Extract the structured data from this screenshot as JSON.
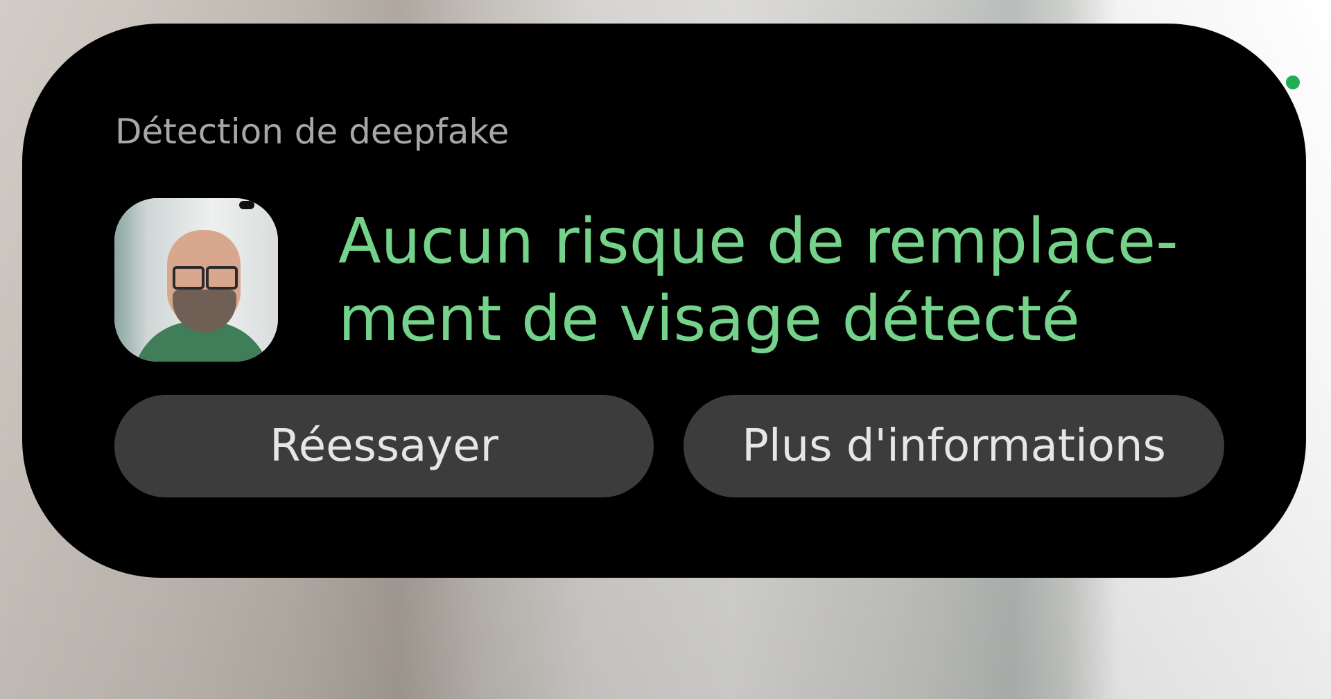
{
  "notification": {
    "title": "Détection de deepfake",
    "headline_line1": "Aucun risque de remplace-",
    "headline_line2": "ment de visage détecté",
    "buttons": {
      "retry": "Réessayer",
      "more_info": "Plus d'informations"
    }
  },
  "colors": {
    "card_background": "#000000",
    "headline": "#74d28a",
    "title": "#a7a7a7",
    "button_background": "#3c3c3c",
    "button_text": "#e6e6e6",
    "privacy_indicator": "#1fae56"
  },
  "icons": {
    "avatar": "person-photo-thumbnail",
    "indicator": "camera-privacy-dot"
  }
}
